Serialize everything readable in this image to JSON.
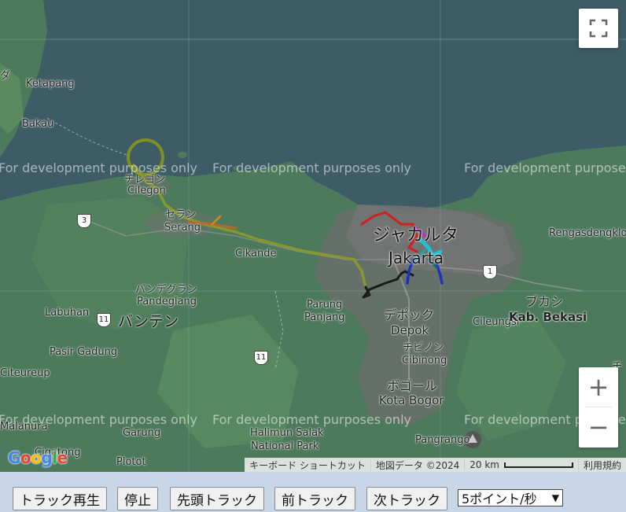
{
  "map": {
    "places": {
      "ketapang": "Ketapang",
      "bakau": "Bakau",
      "cilegon_jp": "チレゴン",
      "cilegon": "Cilegon",
      "serang_jp": "セラン",
      "serang": "Serang",
      "cikande": "Cikande",
      "pandeglang_jp": "パンデグラン",
      "pandeglang": "Pandeglang",
      "labuhan": "Labuhan",
      "banten_jp": "バンテン",
      "pasir_gadung": "Pasir Gadung",
      "citeureup": "Citeureup",
      "malanura": "Malanura",
      "garung": "Garung",
      "cigatong": "Cigatong",
      "plotot": "Plotot",
      "jakarta_jp": "ジャカルタ",
      "jakarta": "Jakarta",
      "parung": "Parung",
      "panjang": "Panjang",
      "depok_jp": "デポック",
      "depok": "Depok",
      "cileungsi": "Cileungsi",
      "cibinong_jp": "チビノン",
      "cibinong": "Cibinong",
      "bogor_jp": "ボゴール",
      "kota_bogor": "Kota Bogor",
      "halimun_salak": "Halimun Salak",
      "national_park": "National Park",
      "pangrango": "Pangrango",
      "rengasdengklok": "Rengasdengklok",
      "bekasi_jp": "ブカシ",
      "kab_bekasi": "Kab. Bekasi",
      "left_fragment": "ダ",
      "right_fragment": "チ"
    },
    "route_shields": [
      "3",
      "11",
      "11",
      "1"
    ],
    "watermark": "For development purposes only",
    "attribution": {
      "shortcuts": "キーボード ショートカット",
      "map_data": "地図データ ©2024",
      "scale": "20 km",
      "terms": "利用規約"
    },
    "logo": [
      "G",
      "o",
      "o",
      "g",
      "l",
      "e"
    ],
    "logo_colors": [
      "#4285F4",
      "#EA4335",
      "#FBBC05",
      "#4285F4",
      "#34A853",
      "#EA4335"
    ],
    "zoom_in": "+",
    "zoom_out": "−"
  },
  "controls": {
    "play": "トラック再生",
    "stop": "停止",
    "first": "先頭トラック",
    "prev": "前トラック",
    "next": "次トラック",
    "speed": "5ポイント/秒"
  },
  "colors": {
    "sea": "#3d5c66",
    "land": "#4d7a5c",
    "urban": "#707070",
    "controls_bg": "#c9d6e8"
  }
}
